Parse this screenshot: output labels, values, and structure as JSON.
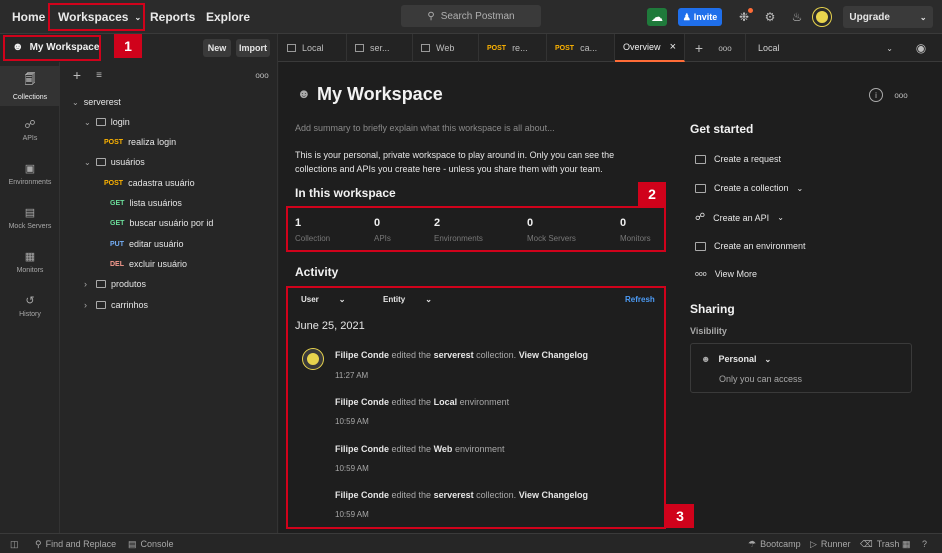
{
  "topbar": {
    "home": "Home",
    "workspaces": "Workspaces",
    "reports": "Reports",
    "explore": "Explore",
    "search_placeholder": "Search Postman",
    "invite": "Invite",
    "upgrade": "Upgrade"
  },
  "workspace_bar": {
    "name": "My Workspace",
    "new_label": "New",
    "import_label": "Import"
  },
  "tabs": [
    {
      "method": "",
      "label": "Local"
    },
    {
      "method": "",
      "label": "ser..."
    },
    {
      "method": "",
      "label": "Web"
    },
    {
      "method": "POST",
      "label": "re..."
    },
    {
      "method": "POST",
      "label": "ca..."
    },
    {
      "method": "",
      "label": "Overview"
    }
  ],
  "tab_more": "ooo",
  "environment_select": "Local",
  "rail": [
    {
      "label": "Collections"
    },
    {
      "label": "APIs"
    },
    {
      "label": "Environments"
    },
    {
      "label": "Mock Servers"
    },
    {
      "label": "Monitors"
    },
    {
      "label": "History"
    }
  ],
  "tree": {
    "collection": "serverest",
    "login_folder": "login",
    "login_req": {
      "method": "POST",
      "label": "realiza login"
    },
    "usuarios_folder": "usuários",
    "usuarios_reqs": [
      {
        "method": "POST",
        "label": "cadastra usuário"
      },
      {
        "method": "GET",
        "label": "lista usuários"
      },
      {
        "method": "GET",
        "label": "buscar usuário por id"
      },
      {
        "method": "PUT",
        "label": "editar usuário"
      },
      {
        "method": "DEL",
        "label": "excluir usuário"
      }
    ],
    "produtos_folder": "produtos",
    "carrinhos_folder": "carrinhos"
  },
  "overview": {
    "title": "My Workspace",
    "summary_placeholder": "Add summary to briefly explain what this workspace is all about...",
    "description_line1": "This is your personal, private workspace to play around in. Only you can see the",
    "description_line2": "collections and APIs you create here - unless you share them with your team.",
    "in_this_workspace": "In this workspace",
    "stats": [
      {
        "num": "1",
        "label": "Collection"
      },
      {
        "num": "0",
        "label": "APIs"
      },
      {
        "num": "2",
        "label": "Environments"
      },
      {
        "num": "0",
        "label": "Mock Servers"
      },
      {
        "num": "0",
        "label": "Monitors"
      }
    ],
    "activity_title": "Activity",
    "filter_user": "User",
    "filter_entity": "Entity",
    "refresh": "Refresh",
    "date": "June 25, 2021",
    "activities": [
      {
        "user": "Filipe Conde",
        "verb": "edited the",
        "target": "serverest",
        "kind": "collection.",
        "link": "View Changelog",
        "time": "11:27 AM"
      },
      {
        "user": "Filipe Conde",
        "verb": "edited the",
        "target": "Local",
        "kind": "environment",
        "link": "",
        "time": "10:59 AM"
      },
      {
        "user": "Filipe Conde",
        "verb": "edited the",
        "target": "Web",
        "kind": "environment",
        "link": "",
        "time": "10:59 AM"
      },
      {
        "user": "Filipe Conde",
        "verb": "edited the",
        "target": "serverest",
        "kind": "collection.",
        "link": "View Changelog",
        "time": "10:59 AM"
      }
    ]
  },
  "get_started": {
    "title": "Get started",
    "items": [
      "Create a request",
      "Create a collection",
      "Create an API",
      "Create an environment",
      "View More"
    ]
  },
  "sharing": {
    "title": "Sharing",
    "visibility": "Visibility",
    "personal": "Personal",
    "personal_desc": "Only you can access"
  },
  "annotations": [
    "1",
    "2",
    "3"
  ],
  "statusbar": {
    "find_replace": "Find and Replace",
    "console": "Console",
    "bootcamp": "Bootcamp",
    "runner": "Runner",
    "trash": "Trash"
  },
  "colors": {
    "accent": "#ff6c37",
    "annotation_red": "#d0021b",
    "invite_blue": "#1f6feb",
    "link_blue": "#4c9bf5"
  }
}
